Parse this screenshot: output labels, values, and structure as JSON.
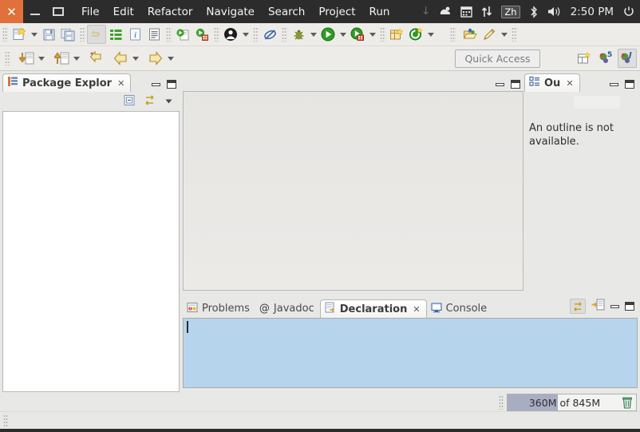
{
  "window": {
    "controls": {
      "close": "✕",
      "minimize": "minimize",
      "maximize": "maximize"
    },
    "close_color": "#e2703a"
  },
  "menubar": {
    "items": [
      {
        "label": "File",
        "name": "menu-file"
      },
      {
        "label": "Edit",
        "name": "menu-edit"
      },
      {
        "label": "Refactor",
        "name": "menu-refactor"
      },
      {
        "label": "Navigate",
        "name": "menu-navigate"
      },
      {
        "label": "Search",
        "name": "menu-search"
      },
      {
        "label": "Project",
        "name": "menu-project"
      },
      {
        "label": "Run",
        "name": "menu-run"
      }
    ]
  },
  "tray": {
    "icons": [
      {
        "name": "dropdown-arrow-icon",
        "glyph": "↓"
      },
      {
        "name": "ubuntu-one-icon",
        "glyph": "✽"
      },
      {
        "name": "calendar-icon",
        "glyph": "▦"
      },
      {
        "name": "network-icon",
        "glyph": "⇅"
      }
    ],
    "input_method": "Zh",
    "bluetooth": "ᛦ",
    "volume": "◂))",
    "clock": "2:50 PM",
    "session": "⚙"
  },
  "toolbar": {
    "row1": [
      {
        "name": "new-file-button",
        "glyph": "new"
      },
      {
        "name": "new-file-dropdown",
        "glyph": "caret"
      },
      {
        "name": "save-button",
        "glyph": "save"
      },
      {
        "name": "save-all-button",
        "glyph": "saveall"
      },
      {
        "name": "link-editor-button",
        "glyph": "link",
        "pressed": true
      },
      {
        "name": "list-view-button",
        "glyph": "list"
      },
      {
        "name": "info-button",
        "glyph": "info"
      },
      {
        "name": "document-button",
        "glyph": "doc"
      },
      {
        "name": "run-last-tool-button",
        "glyph": "runtool1"
      },
      {
        "name": "external-tools-button",
        "glyph": "runtool2"
      },
      {
        "name": "user-button",
        "glyph": "user"
      },
      {
        "name": "user-dropdown",
        "glyph": "caret"
      },
      {
        "name": "skip-breakpoints-button",
        "glyph": "skip"
      },
      {
        "name": "debug-button",
        "glyph": "debug"
      },
      {
        "name": "debug-dropdown",
        "glyph": "caret"
      },
      {
        "name": "run-button",
        "glyph": "run"
      },
      {
        "name": "run-dropdown",
        "glyph": "caret"
      },
      {
        "name": "coverage-button",
        "glyph": "coverage"
      },
      {
        "name": "coverage-dropdown",
        "glyph": "caret"
      },
      {
        "name": "new-package-button",
        "glyph": "newpkg"
      },
      {
        "name": "refresh-button",
        "glyph": "refresh"
      },
      {
        "name": "refresh-dropdown",
        "glyph": "caret"
      },
      {
        "name": "open-resource-button",
        "glyph": "openres"
      },
      {
        "name": "edit-button",
        "glyph": "pencil"
      },
      {
        "name": "edit-dropdown",
        "glyph": "caret"
      }
    ],
    "row2": [
      {
        "name": "next-annotation-button",
        "glyph": "nextanno"
      },
      {
        "name": "next-annotation-dropdown",
        "glyph": "caret"
      },
      {
        "name": "previous-annotation-button",
        "glyph": "prevanno"
      },
      {
        "name": "previous-annotation-dropdown",
        "glyph": "caret"
      },
      {
        "name": "last-edit-location-button",
        "glyph": "lastedit"
      },
      {
        "name": "back-button",
        "glyph": "back"
      },
      {
        "name": "back-dropdown",
        "glyph": "caret"
      },
      {
        "name": "forward-button",
        "glyph": "forward"
      },
      {
        "name": "forward-dropdown",
        "glyph": "caret"
      }
    ],
    "quick_access_placeholder": "Quick Access",
    "perspectives": [
      {
        "name": "open-perspective-button",
        "label": "open"
      },
      {
        "name": "perspective-java-ee",
        "label": "Java EE",
        "selected": false
      },
      {
        "name": "perspective-java",
        "label": "Java",
        "selected": true
      }
    ]
  },
  "package_explorer": {
    "tab_label": "Package Explor",
    "close_glyph": "✕",
    "toolbar": [
      {
        "name": "collapse-all-button",
        "glyph": "collapse"
      },
      {
        "name": "link-with-editor-button",
        "glyph": "link"
      },
      {
        "name": "view-menu-button",
        "glyph": "caret"
      }
    ],
    "content": ""
  },
  "editor_area": {
    "content": "",
    "buttons": [
      {
        "name": "minimize-button"
      },
      {
        "name": "maximize-button"
      }
    ]
  },
  "outline": {
    "tab_label": "Ou",
    "close_glyph": "✕",
    "message": "An outline is not available."
  },
  "bottom_panel": {
    "tabs": [
      {
        "label": "Problems",
        "name": "tab-problems",
        "icon": "problems-icon",
        "active": false,
        "closable": false
      },
      {
        "label": "Javadoc",
        "name": "tab-javadoc",
        "icon": "javadoc-icon",
        "active": false,
        "closable": false
      },
      {
        "label": "Declaration",
        "name": "tab-declaration",
        "icon": "declaration-icon",
        "active": true,
        "closable": true
      },
      {
        "label": "Console",
        "name": "tab-console",
        "icon": "console-icon",
        "active": false,
        "closable": false
      }
    ],
    "close_glyph": "✕",
    "toolbar": [
      {
        "name": "link-with-selection-button",
        "glyph": "link",
        "pressed": true
      },
      {
        "name": "pin-selection-button",
        "glyph": "pin"
      }
    ],
    "content": "",
    "content_bg": "#b7d4ed"
  },
  "heap_status": {
    "label": "360M of 845M",
    "used": "360M",
    "total": "845M",
    "percent": 43,
    "gc_icon": "trash-icon",
    "fill_color": "#a9adc4"
  },
  "colors": {
    "panel_bg": "#e8e8e6",
    "topbar_bg": "#2c2c2c",
    "accent_close": "#e2703a",
    "declaration_bg": "#b7d4ed"
  }
}
